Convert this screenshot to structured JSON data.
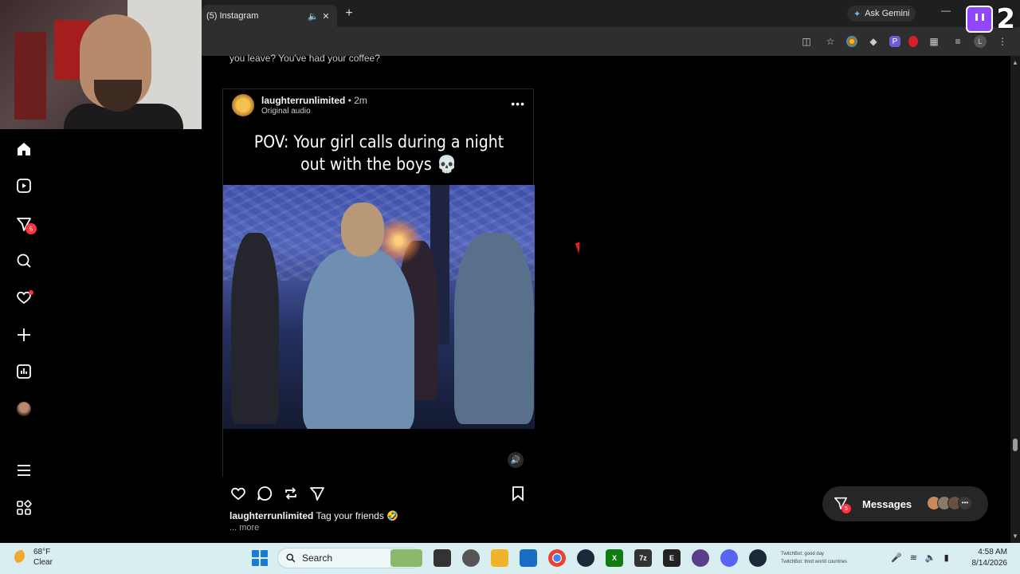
{
  "browser": {
    "tab_title": "(5) Instagram",
    "gemini_label": "Ask Gemini",
    "profile_initial": "L"
  },
  "twitch_overlay": {
    "count": "2"
  },
  "sidebar": {
    "notifications_badge": "5"
  },
  "feed": {
    "previous_caption": "you leave? You've had your coffee?"
  },
  "post": {
    "username": "laughterrunlimited",
    "separator": "•",
    "time": "2m",
    "audio": "Original audio",
    "meme_text_line1": "POV: Your girl calls during a night",
    "meme_text_line2": "out with the boys 💀",
    "caption_user": "laughterrunlimited",
    "caption_text": "Tag your friends 🤣",
    "more_label": "... more"
  },
  "messages": {
    "label": "Messages",
    "badge": "5"
  },
  "taskbar": {
    "temperature": "68°F",
    "condition": "Clear",
    "search_label": "Search",
    "tray_line1": "TwitchBot: good day",
    "tray_line2": "TwitchBot: third world countries",
    "time": "4:58 AM",
    "date": "8/14/2026"
  },
  "colors": {
    "instagram_badge": "#ff3040",
    "twitch_purple": "#9146ff",
    "taskbar_bg": "#d9eef0"
  }
}
